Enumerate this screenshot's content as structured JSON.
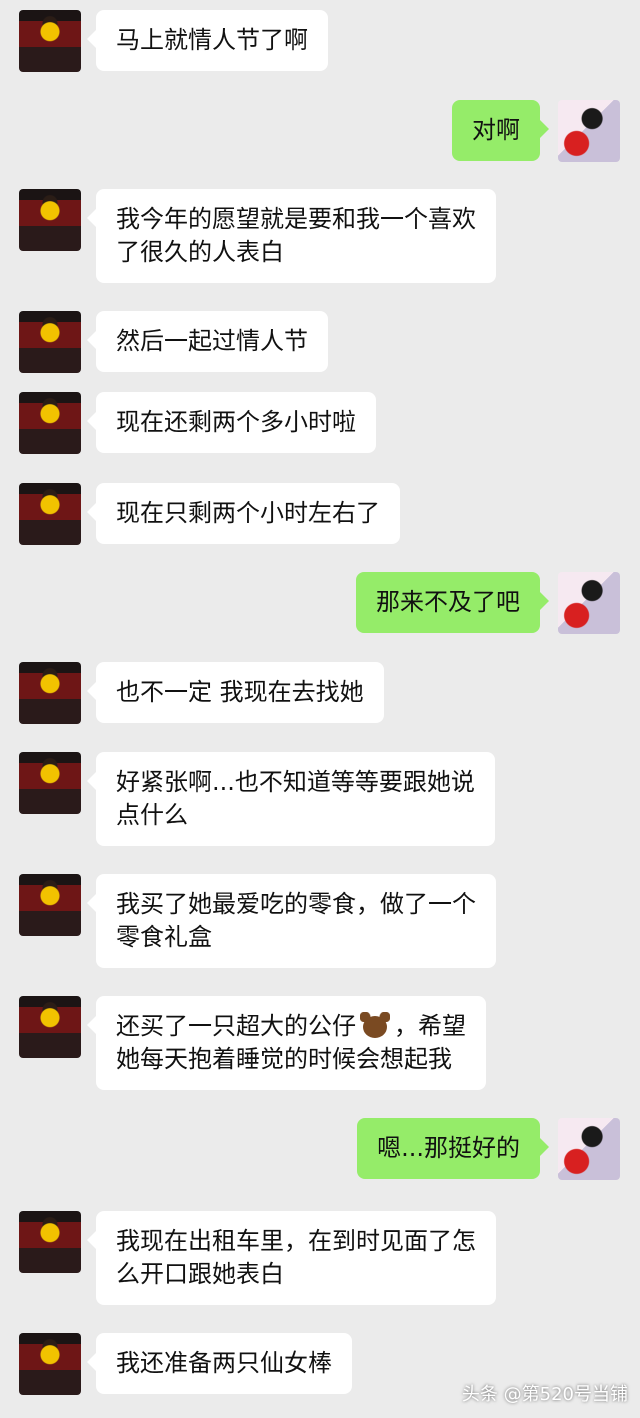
{
  "messages": [
    {
      "side": "left",
      "lines": [
        "马上就情人节了啊"
      ]
    },
    {
      "side": "right",
      "lines": [
        "对啊"
      ]
    },
    {
      "side": "left",
      "lines": [
        "我今年的愿望就是要和我一个喜欢",
        "了很久的人表白"
      ]
    },
    {
      "side": "left",
      "lines": [
        "然后一起过情人节"
      ]
    },
    {
      "side": "left",
      "lines": [
        "现在还剩两个多小时啦"
      ]
    },
    {
      "side": "left",
      "lines": [
        "现在只剩两个小时左右了"
      ]
    },
    {
      "side": "right",
      "lines": [
        "那来不及了吧"
      ]
    },
    {
      "side": "left",
      "lines": [
        "也不一定 我现在去找她"
      ]
    },
    {
      "side": "left",
      "lines": [
        "好紧张啊...也不知道等等要跟她说",
        "点什么"
      ]
    },
    {
      "side": "left",
      "lines": [
        "我买了她最爱吃的零食，做了一个",
        "零食礼盒"
      ]
    },
    {
      "side": "left",
      "lines": [
        "还买了一只超大的公仔",
        "，希望",
        "她每天抱着睡觉的时候会想起我"
      ],
      "emoji": "bear-icon"
    },
    {
      "side": "right",
      "lines": [
        "嗯...那挺好的"
      ]
    },
    {
      "side": "left",
      "lines": [
        "我现在出租车里，在到时见面了怎",
        "么开口跟她表白"
      ]
    },
    {
      "side": "left",
      "lines": [
        "我还准备两只仙女棒"
      ]
    }
  ],
  "watermark": "头条 @第520号当铺"
}
